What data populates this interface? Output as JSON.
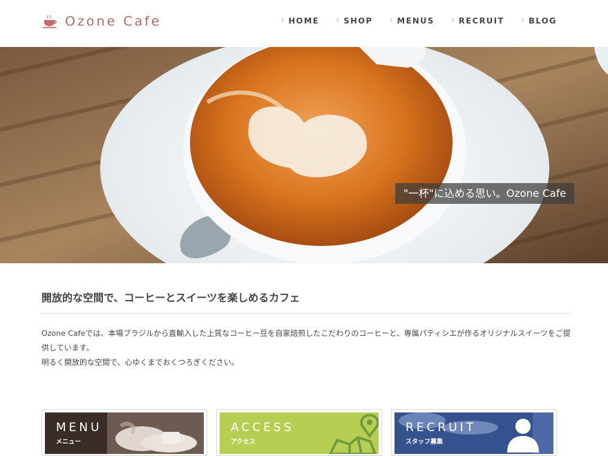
{
  "header": {
    "logo_text": "Ozone Cafe",
    "nav": [
      {
        "label": "HOME"
      },
      {
        "label": "SHOP"
      },
      {
        "label": "MENUS"
      },
      {
        "label": "RECRUIT"
      },
      {
        "label": "BLOG"
      }
    ]
  },
  "hero": {
    "caption": "\"一杯\"に込める思い。Ozone Cafe"
  },
  "intro": {
    "heading": "開放的な空間で、コーヒーとスイーツを楽しめるカフェ",
    "paragraph_1": "Ozone Cafeでは、本場ブラジルから直輸入した上質なコーヒー豆を自家焙煎したこだわりのコーヒーと、専属パティシエが作るオリジナルスイーツをご提供しています。",
    "paragraph_2": "明るく開放的な空間で、心ゆくまでおくつろぎください。"
  },
  "banners": [
    {
      "title": "MENU",
      "subtitle": "メニュー"
    },
    {
      "title": "ACCESS",
      "subtitle": "アクセス"
    },
    {
      "title": "RECRUIT",
      "subtitle": "スタッフ募集"
    }
  ],
  "colors": {
    "logo": "#b26a6a",
    "access_green": "#b6cf52",
    "recruit_blue": "#3f5fa0"
  },
  "icons": [
    "coffee-cup-icon",
    "chevron-right-icon",
    "map-pin-icon",
    "user-silhouette-icon"
  ]
}
